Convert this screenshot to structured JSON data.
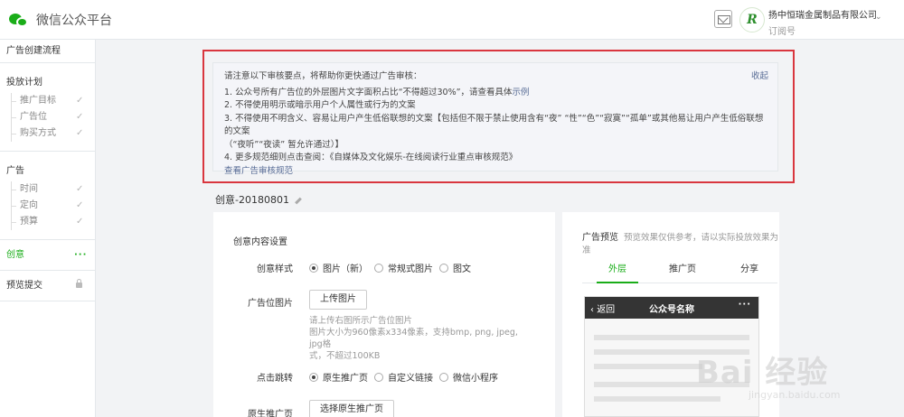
{
  "header": {
    "app_title": "微信公众平台",
    "account_name": "扬中恒瑞金属制品有限公司",
    "account_type": "订阅号",
    "account_avatar_text": "R",
    "icons": {
      "logo": "wechat-logo-icon",
      "mail": "mail-icon",
      "dropdown": "chevron-down-icon"
    }
  },
  "sidebar": {
    "title": "广告创建流程",
    "groups": [
      {
        "label": "投放计划",
        "items": [
          {
            "label": "推广目标",
            "mark": "✓"
          },
          {
            "label": "广告位",
            "mark": "✓"
          },
          {
            "label": "购买方式",
            "mark": "✓"
          }
        ]
      },
      {
        "label": "广告",
        "items": [
          {
            "label": "时间",
            "mark": "✓"
          },
          {
            "label": "定向",
            "mark": "✓"
          },
          {
            "label": "预算",
            "mark": "✓"
          }
        ]
      }
    ],
    "creative": {
      "label": "创意",
      "indicator": "···"
    },
    "preview_submit": {
      "label": "预览提交"
    }
  },
  "notice": {
    "title": "请注意以下审核要点，将帮助你更快通过广告审核：",
    "collapse_label": "收起",
    "items": [
      "1. 公众号所有广告位的外层图片文字面积占比“不得超过30%”，请查看具体",
      "2. 不得使用明示或暗示用户个人属性或行为的文案",
      "3. 不得使用不明含义、容易让用户产生低俗联想的文案【包括但不限于禁止使用含有“夜” “性”“色”“寂寞”“孤单”或其他易让用户产生低俗联想的文案",
      "（“夜听”“夜读” 暂允许通过）】",
      "4. 更多规范细则点击查阅：《自媒体及文化娱乐-在线阅读行业重点审核规范》"
    ],
    "example_link": "示例",
    "view_rules_link": "查看广告审核规范"
  },
  "creative": {
    "name": "创意-20180801"
  },
  "form": {
    "section_title": "创意内容设置",
    "style": {
      "label": "创意样式",
      "options": [
        "图片（新）",
        "常规式图片",
        "图文"
      ],
      "selected": 0
    },
    "ad_image": {
      "label": "广告位图片",
      "button": "上传图片",
      "hints": [
        "请上传右图所示广告位图片",
        "图片大小为960像素x334像素，支持bmp, png, jpeg, jpg格",
        "式，不超过100KB"
      ]
    },
    "jump": {
      "label": "点击跳转",
      "options": [
        "原生推广页",
        "自定义链接",
        "微信小程序"
      ],
      "selected": 0
    },
    "native_page": {
      "label": "原生推广页",
      "button": "选择原生推广页"
    }
  },
  "preview": {
    "title": "广告预览",
    "note": "预览效果仅供参考，请以实际投放效果为准",
    "tabs": [
      "外层",
      "推广页",
      "分享"
    ],
    "active_tab": 0,
    "phone": {
      "back_label": "返回",
      "title": "公众号名称",
      "more": "···"
    }
  },
  "watermark": {
    "text": "Bai 经验",
    "sub": "jingyan.baidu.com"
  }
}
